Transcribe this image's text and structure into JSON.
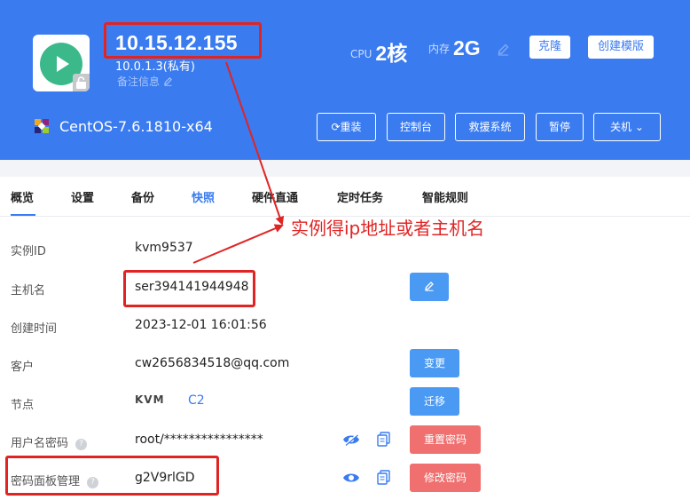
{
  "header": {
    "ip_public": "10.15.12.155",
    "ip_private": "10.0.1.3(私有)",
    "remark": "备注信息",
    "cpu_label": "CPU",
    "cpu_value": "2核",
    "mem_label": "内存",
    "mem_value": "2G",
    "clone_label": "克隆",
    "create_template_label": "创建模版",
    "os_name": "CentOS-7.6.1810-x64",
    "actions": [
      "重装",
      "控制台",
      "救援系统",
      "暂停",
      "关机"
    ]
  },
  "tabs": [
    "概览",
    "设置",
    "备份",
    "快照",
    "硬件直通",
    "定时任务",
    "智能规则"
  ],
  "annotation": "实例得ip地址或者主机名",
  "details": {
    "instance_id_label": "实例ID",
    "instance_id": "kvm9537",
    "hostname_label": "主机名",
    "hostname": "ser394141944948",
    "created_label": "创建时间",
    "created": "2023-12-01 16:01:56",
    "customer_label": "客户",
    "customer": "cw2656834518@qq.com",
    "customer_btn": "变更",
    "node_label": "节点",
    "node_logo": "KVM",
    "node_value": "C2",
    "node_btn": "迁移",
    "userpass_label": "用户名密码",
    "userpass_value": "root/****************",
    "reset_pwd_btn": "重置密码",
    "panel_pwd_label": "密码面板管理",
    "panel_pwd_value": "g2V9rlGD",
    "change_pwd_btn": "修改密码"
  },
  "colors": {
    "primary": "#3a7bf0",
    "danger": "#f06f6f",
    "annotation": "#e02424",
    "running": "#3cb98a"
  }
}
